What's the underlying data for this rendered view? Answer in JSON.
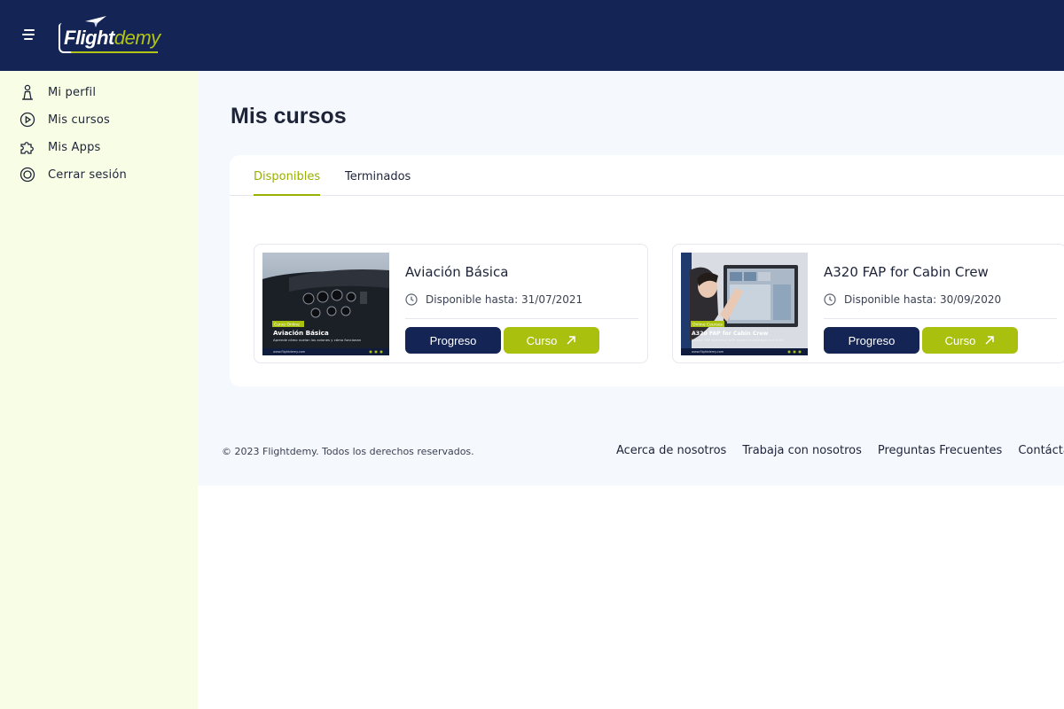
{
  "brand": {
    "logo_text_bold": "Flight",
    "logo_text_light": "demy",
    "navy": "#132455",
    "accent": "#a9c00f"
  },
  "sidebar": {
    "items": [
      {
        "label": "Mi perfil",
        "icon": "user-icon"
      },
      {
        "label": "Mis cursos",
        "icon": "play-circle-icon"
      },
      {
        "label": "Mis Apps",
        "icon": "puzzle-icon"
      },
      {
        "label": "Cerrar sesión",
        "icon": "power-icon"
      }
    ]
  },
  "main": {
    "title": "Mis cursos",
    "tabs": [
      {
        "label": "Disponibles",
        "active": true
      },
      {
        "label": "Terminados",
        "active": false
      }
    ],
    "courses": [
      {
        "title": "Aviación Básica",
        "availability": "Disponible hasta: 31/07/2021",
        "progress_label": "Progreso",
        "course_label": "Curso",
        "thumb": {
          "badge": "Curso Online",
          "title": "Aviación Básica",
          "subtitle": "Aprende cómo vuelan los aviones y cómo funcionan",
          "url": "www.flightdemy.com"
        }
      },
      {
        "title": "A320 FAP for Cabin Crew",
        "availability": "Disponible hasta: 30/09/2020",
        "progress_label": "Progreso",
        "course_label": "Curso",
        "thumb": {
          "badge": "Online Courses",
          "title": "A320 FAP for Cabin Crew",
          "subtitle": "Master FAP operation with expert knowledge and skills",
          "url": "www.flightdemy.com"
        }
      }
    ]
  },
  "footer": {
    "copyright": "© 2023 Flightdemy. Todos los derechos reservados.",
    "links": [
      "Acerca de nosotros",
      "Trabaja con nosotros",
      "Preguntas Frecuentes",
      "Contáctanos"
    ]
  }
}
